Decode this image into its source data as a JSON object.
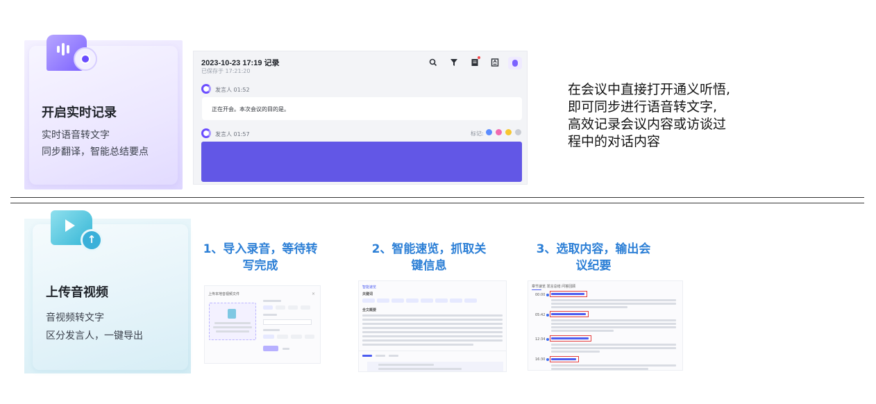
{
  "top_feature": {
    "title": "开启实时记录",
    "desc_line1": "实时语音转文字",
    "desc_line2": "同步翻译，智能总结要点",
    "icon": "microphone-record-icon"
  },
  "record_screen": {
    "title": "2023-10-23 17:19 记录",
    "saved": "已保存于 17:21:20",
    "toolbar_icons": [
      "search-icon",
      "filter-icon",
      "notes-icon",
      "export-icon",
      "assistant-avatar"
    ],
    "speaker1": "发言人  01:52",
    "speaker1_text": "正在开会。本次会议的目的是。",
    "speaker2": "发言人  01:57",
    "mark_label": "标记:",
    "tag_colors": [
      "#5b8cff",
      "#f06ab0",
      "#f7c62f",
      "#c9ccd3"
    ]
  },
  "intro": {
    "line1": "在会议中直接打开通义听悟,",
    "line2": "即可同步进行语音转文字,",
    "line3": "高效记录会议内容或访谈过",
    "line4": "程中的对话内容"
  },
  "bottom_feature": {
    "title": "上传音视频",
    "desc_line1": "音视频转文字",
    "desc_line2": "区分发言人，一键导出",
    "icon": "video-upload-icon"
  },
  "steps": [
    {
      "line1": "1、导入录音，等待转",
      "line2": "写完成"
    },
    {
      "line1": "2、智能速览，抓取关",
      "line2": "键信息"
    },
    {
      "line1": "3、选取内容，输出会",
      "line2": "议纪要"
    }
  ],
  "thumbs": {
    "t1_title": "上传本地音视频文件",
    "t2_title": "智能速览",
    "t2_tab": "关键词",
    "t2_section": "全文概要",
    "t3_tabs": "章节速览   发言总结   问答回顾",
    "t3_times": [
      "00:00",
      "05:42",
      "12:34",
      "16:30"
    ]
  },
  "colors": {
    "accent_purple": "#6257e6",
    "step_blue": "#2c7fd6"
  }
}
